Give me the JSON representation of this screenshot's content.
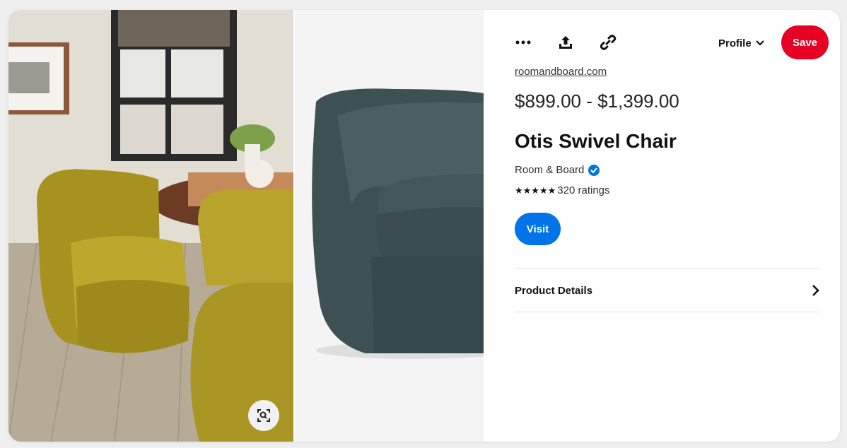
{
  "toolbar": {
    "more_icon": "more-icon",
    "share_icon": "share-icon",
    "link_icon": "link-icon",
    "profile_label": "Profile",
    "save_label": "Save"
  },
  "product": {
    "source": "roomandboard.com",
    "price": "$899.00 - $1,399.00",
    "title": "Otis Swivel Chair",
    "brand": "Room & Board",
    "stars": "★★★★★",
    "ratings": "320 ratings",
    "visit_label": "Visit",
    "details_label": "Product Details"
  },
  "colors": {
    "save": "#e60023",
    "visit": "#0074e8",
    "verified": "#0074e8"
  }
}
